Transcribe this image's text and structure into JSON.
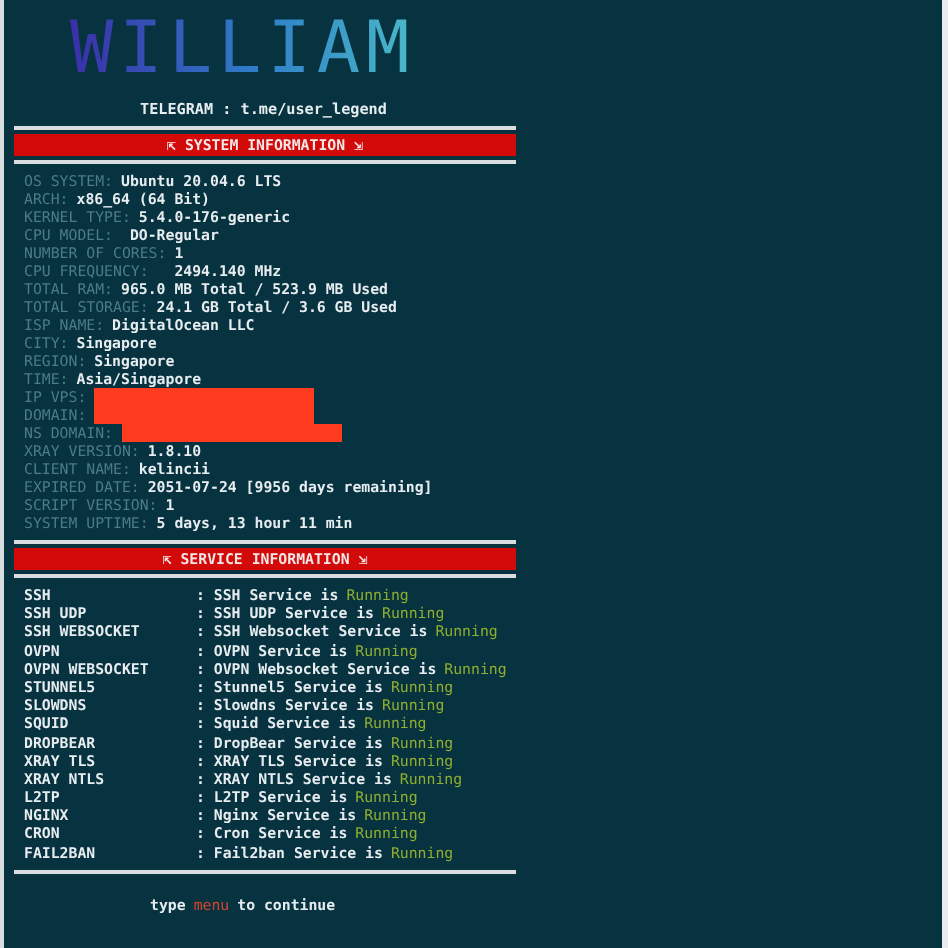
{
  "logo": "WILLIAM",
  "telegram": "TELEGRAM : t.me/user_legend",
  "system_header": "⇱ SYSTEM INFORMATION ⇲",
  "system_info": [
    {
      "kind": "text",
      "label": "OS SYSTEM:",
      "value": "Ubuntu 20.04.6 LTS"
    },
    {
      "kind": "text",
      "label": "ARCH:",
      "value": "x86_64 (64 Bit)"
    },
    {
      "kind": "text",
      "label": "KERNEL TYPE:",
      "value": "5.4.0-176-generic"
    },
    {
      "kind": "text",
      "label": "CPU MODEL:",
      "value": " DO-Regular"
    },
    {
      "kind": "text",
      "label": "NUMBER OF CORES:",
      "value": "1"
    },
    {
      "kind": "text",
      "label": "CPU FREQUENCY:",
      "value": "  2494.140 MHz"
    },
    {
      "kind": "text",
      "label": "TOTAL RAM:",
      "value": "965.0 MB Total / 523.9 MB Used"
    },
    {
      "kind": "text",
      "label": "TOTAL STORAGE:",
      "value": "24.1 GB Total / 3.6 GB Used"
    },
    {
      "kind": "text",
      "label": "ISP NAME:",
      "value": "DigitalOcean LLC"
    },
    {
      "kind": "text",
      "label": "CITY:",
      "value": "Singapore"
    },
    {
      "kind": "text",
      "label": "REGION:",
      "value": "Singapore"
    },
    {
      "kind": "text",
      "label": "TIME:",
      "value": "Asia/Singapore"
    },
    {
      "kind": "redacted",
      "label": "IP VPS:"
    },
    {
      "kind": "redacted",
      "label": "DOMAIN:"
    },
    {
      "kind": "redacted",
      "label": "NS DOMAIN:"
    },
    {
      "kind": "text",
      "label": "XRAY VERSION:",
      "value": "1.8.10"
    },
    {
      "kind": "text",
      "label": "CLIENT NAME:",
      "value": "kelincii"
    },
    {
      "kind": "text",
      "label": "EXPIRED DATE:",
      "value": "2051-07-24 [9956 days remaining]"
    },
    {
      "kind": "text",
      "label": "SCRIPT VERSION:",
      "value": "1"
    },
    {
      "kind": "text",
      "label": "SYSTEM UPTIME:",
      "value": "5 days, 13 hour 11 min"
    }
  ],
  "service_header": "⇱ SERVICE INFORMATION ⇲",
  "services": [
    {
      "name": "SSH",
      "message": ": SSH Service is",
      "status": "Running",
      "running": true
    },
    {
      "name": "SSH UDP",
      "message": ": SSH UDP Service is",
      "status": "Running",
      "running": true
    },
    {
      "name": "SSH WEBSOCKET",
      "message": ": SSH Websocket Service is",
      "status": "Running",
      "running": true
    },
    {
      "name": "OVPN",
      "message": ": OVPN Service is",
      "status": "Running",
      "running": true
    },
    {
      "name": "OVPN WEBSOCKET",
      "message": ": OVPN Websocket Service is",
      "status": "Running",
      "running": true
    },
    {
      "name": "STUNNEL5",
      "message": ": Stunnel5 Service is",
      "status": "Running",
      "running": true
    },
    {
      "name": "SLOWDNS",
      "message": ": Slowdns Service is",
      "status": "Running",
      "running": true
    },
    {
      "name": "SQUID",
      "message": ": Squid Service is",
      "status": "Running",
      "running": true
    },
    {
      "name": "DROPBEAR",
      "message": ": DropBear Service is",
      "status": "Running",
      "running": true
    },
    {
      "name": "XRAY TLS",
      "message": ": XRAY TLS Service is",
      "status": "Running",
      "running": true
    },
    {
      "name": "XRAY NTLS",
      "message": ": XRAY NTLS Service is",
      "status": "Running",
      "running": true
    },
    {
      "name": "L2TP",
      "message": ": L2TP Service is",
      "status": "Running",
      "running": true
    },
    {
      "name": "NGINX",
      "message": ": Nginx Service is",
      "status": "Running",
      "running": true
    },
    {
      "name": "CRON",
      "message": ": Cron Service is",
      "status": "Running",
      "running": true
    },
    {
      "name": "FAIL2BAN",
      "message": ": Fail2ban Service is",
      "status": "Running",
      "running": true
    }
  ],
  "prompt": {
    "before": "type",
    "command": "menu",
    "after": "to continue"
  }
}
